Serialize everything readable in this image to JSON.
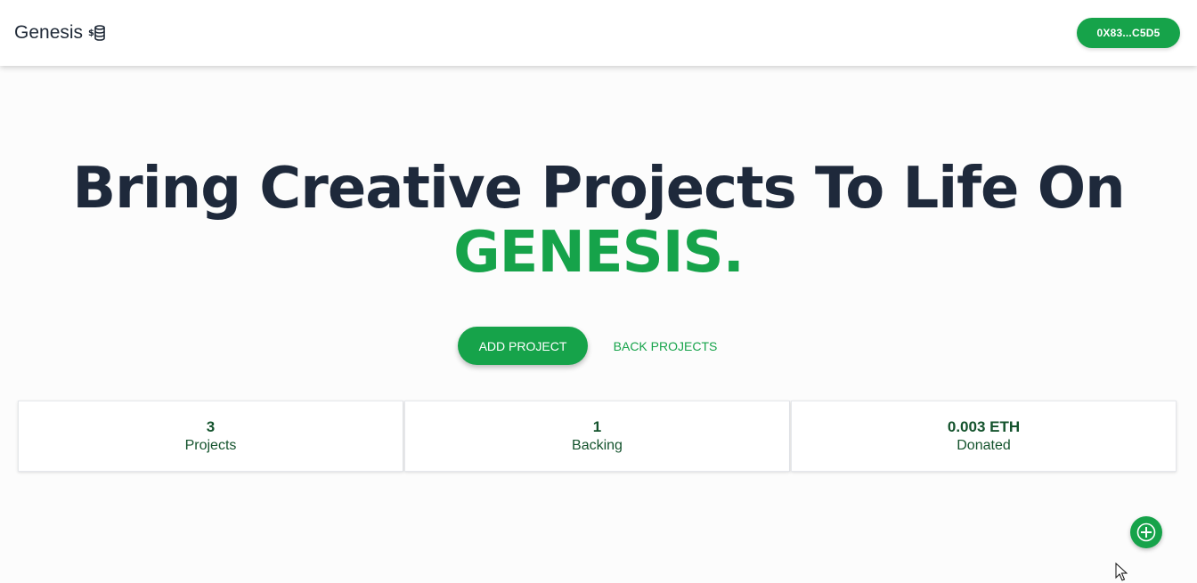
{
  "header": {
    "brand": "Genesis",
    "brand_icon": "money-stack-icon",
    "wallet_label": "0X83...C5D5"
  },
  "hero": {
    "title_line1": "Bring Creative Projects To Life On",
    "title_line2": "GENESIS."
  },
  "actions": {
    "add_label": "ADD PROJECT",
    "back_label": "BACK PROJECTS"
  },
  "stats": [
    {
      "value": "3",
      "label": "Projects"
    },
    {
      "value": "1",
      "label": "Backing"
    },
    {
      "value": "0.003 ETH",
      "label": "Donated"
    }
  ],
  "fab": {
    "icon": "plus-icon"
  },
  "colors": {
    "accent": "#16a34a",
    "heading": "#1e293b",
    "stat_text": "#14532d"
  }
}
